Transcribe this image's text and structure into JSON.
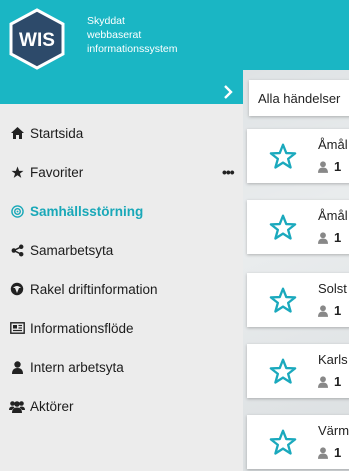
{
  "brand": {
    "logo_text": "WIS",
    "line1": "Skyddat",
    "line2": "webbaserat",
    "line3": "informationssystem"
  },
  "sidebar": {
    "items": [
      {
        "label": "Startsida",
        "icon": "home-icon"
      },
      {
        "label": "Favoriter",
        "icon": "star-icon",
        "more": "•••"
      },
      {
        "label": "Samhällsstörning",
        "icon": "target-icon",
        "active": true
      },
      {
        "label": "Samarbetsyta",
        "icon": "share-icon"
      },
      {
        "label": "Rakel driftinformation",
        "icon": "rakel-icon"
      },
      {
        "label": "Informationsflöde",
        "icon": "newspaper-icon"
      },
      {
        "label": "Intern arbetsyta",
        "icon": "user-icon"
      },
      {
        "label": "Aktörer",
        "icon": "users-icon"
      }
    ]
  },
  "filter": {
    "label": "Alla händelser"
  },
  "events": [
    {
      "title": "Åmål",
      "count": "1"
    },
    {
      "title": "Åmål",
      "count": "1"
    },
    {
      "title": "Solst",
      "count": "1"
    },
    {
      "title": "Karls",
      "count": "1"
    },
    {
      "title": "Värm",
      "count": "1"
    }
  ],
  "colors": {
    "header": "#1ab6c4",
    "accent": "#19a8b8",
    "star": "#1aa9bd"
  }
}
